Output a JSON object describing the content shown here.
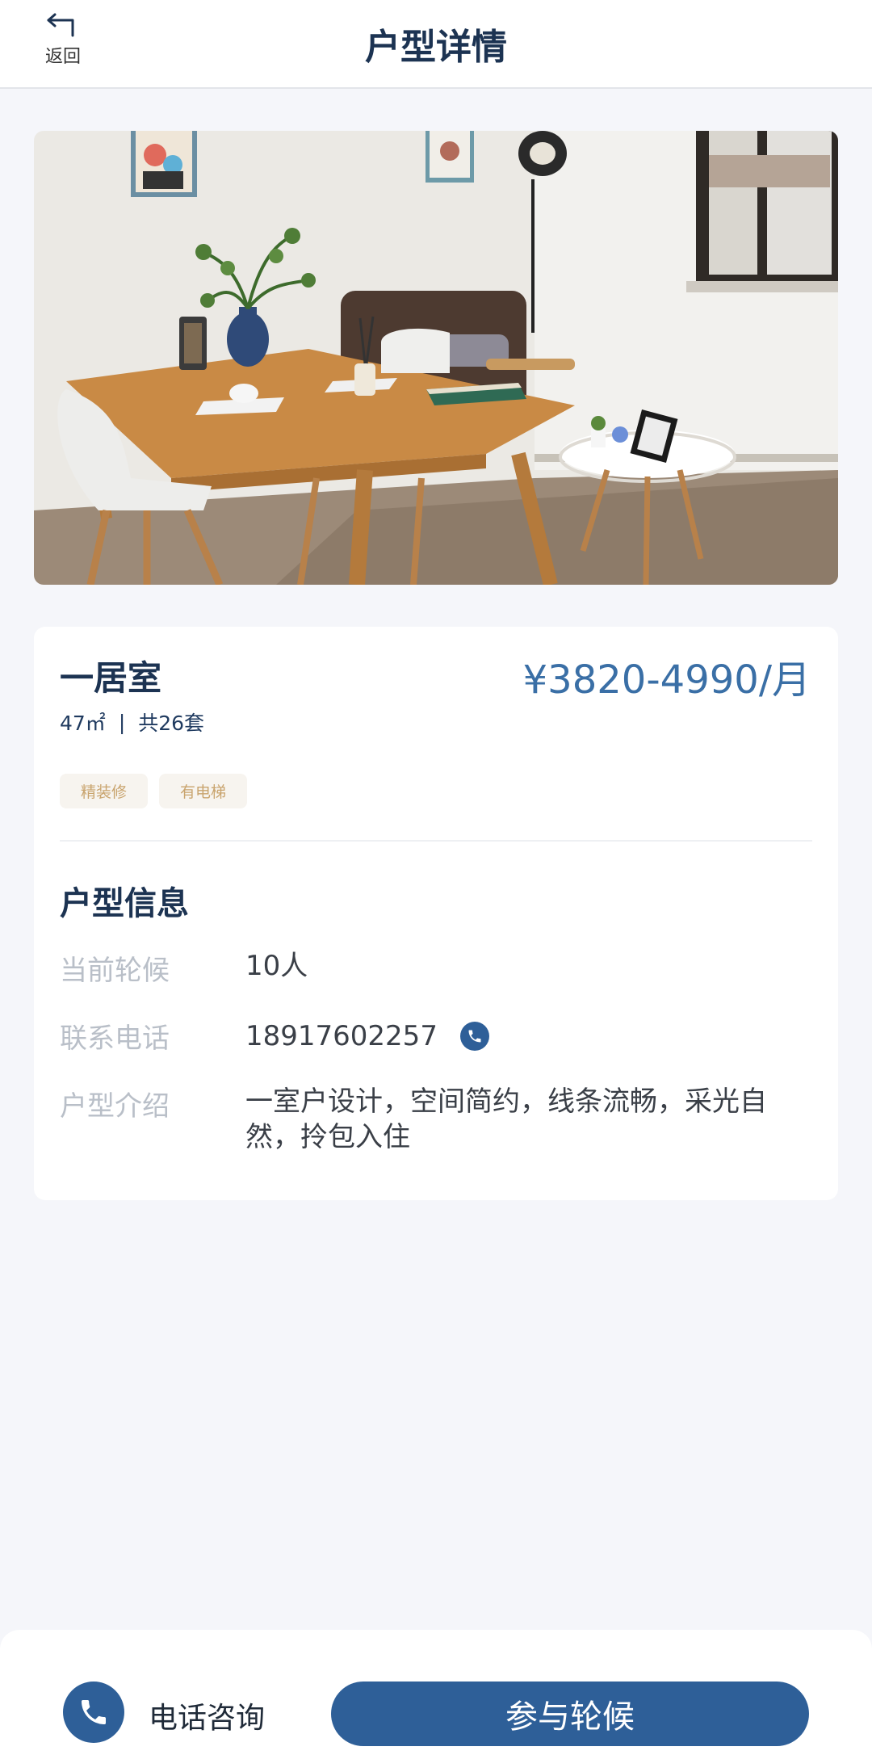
{
  "header": {
    "back_label": "返回",
    "title": "户型详情"
  },
  "unit": {
    "name": "一居室",
    "price": "¥3820-4990/月",
    "area": "47㎡",
    "separator": "|",
    "count": "共26套",
    "tags": [
      "精装修",
      "有电梯"
    ]
  },
  "info": {
    "section_title": "户型信息",
    "rows": [
      {
        "label": "当前轮候",
        "value": "10人"
      },
      {
        "label": "联系电话",
        "value": "18917602257"
      },
      {
        "label": "户型介绍",
        "value": "一室户设计，空间简约，线条流畅，采光自然，拎包入住"
      }
    ]
  },
  "bottom": {
    "call_label": "电话咨询",
    "join_label": "参与轮候"
  },
  "colors": {
    "primary": "#2e5f98",
    "price": "#3a6fa6",
    "tag_text": "#c9a46e",
    "background": "#f5f6fa"
  }
}
